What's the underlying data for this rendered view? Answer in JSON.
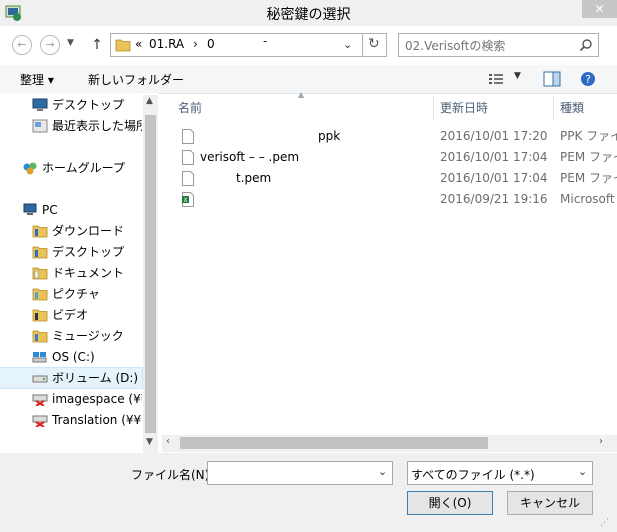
{
  "window": {
    "title": "秘密鍵の選択"
  },
  "address": {
    "prefix": "«",
    "crumb1": "01.RA",
    "sep": "›",
    "crumb2": "0"
  },
  "search": {
    "placeholder": "02.Verisoftの検索"
  },
  "toolbar": {
    "organize": "整理 ▾",
    "new_folder": "新しいフォルダー"
  },
  "nav": {
    "items": [
      {
        "label": "デスクトップ",
        "icon": "desktop-icon"
      },
      {
        "label": "最近表示した場所",
        "icon": "recent-places-icon"
      },
      {
        "label": "ホームグループ",
        "icon": "homegroup-icon"
      },
      {
        "label": "PC",
        "icon": "pc-icon"
      },
      {
        "label": "ダウンロード",
        "icon": "downloads-folder-icon"
      },
      {
        "label": "デスクトップ",
        "icon": "desktop-folder-icon"
      },
      {
        "label": "ドキュメント",
        "icon": "documents-folder-icon"
      },
      {
        "label": "ピクチャ",
        "icon": "pictures-folder-icon"
      },
      {
        "label": "ビデオ",
        "icon": "videos-folder-icon"
      },
      {
        "label": "ミュージック",
        "icon": "music-folder-icon"
      },
      {
        "label": "OS (C:)",
        "icon": "drive-c-icon"
      },
      {
        "label": "ボリューム (D:)",
        "icon": "drive-d-icon"
      },
      {
        "label": "imagespace (¥¥",
        "icon": "network-drive-icon"
      },
      {
        "label": "Translation (¥¥",
        "icon": "network-drive-icon"
      }
    ]
  },
  "columns": {
    "name": "名前",
    "date": "更新日時",
    "type": "種類"
  },
  "files": [
    {
      "name": "ppk",
      "date": "2016/10/01 17:20",
      "type": "PPK ファイ"
    },
    {
      "name": "verisoft – – .pem",
      "date": "2016/10/01 17:04",
      "type": "PEM ファイ"
    },
    {
      "name": "t.pem",
      "date": "2016/10/01 17:04",
      "type": "PEM ファイ"
    },
    {
      "name": "",
      "date": "2016/09/21 19:16",
      "type": "Microsoft"
    }
  ],
  "bottom": {
    "filename_label": "ファイル名(N):",
    "filename_value": "",
    "filter": "すべてのファイル (*.*)",
    "open": "開く(O)",
    "cancel": "キャンセル"
  }
}
